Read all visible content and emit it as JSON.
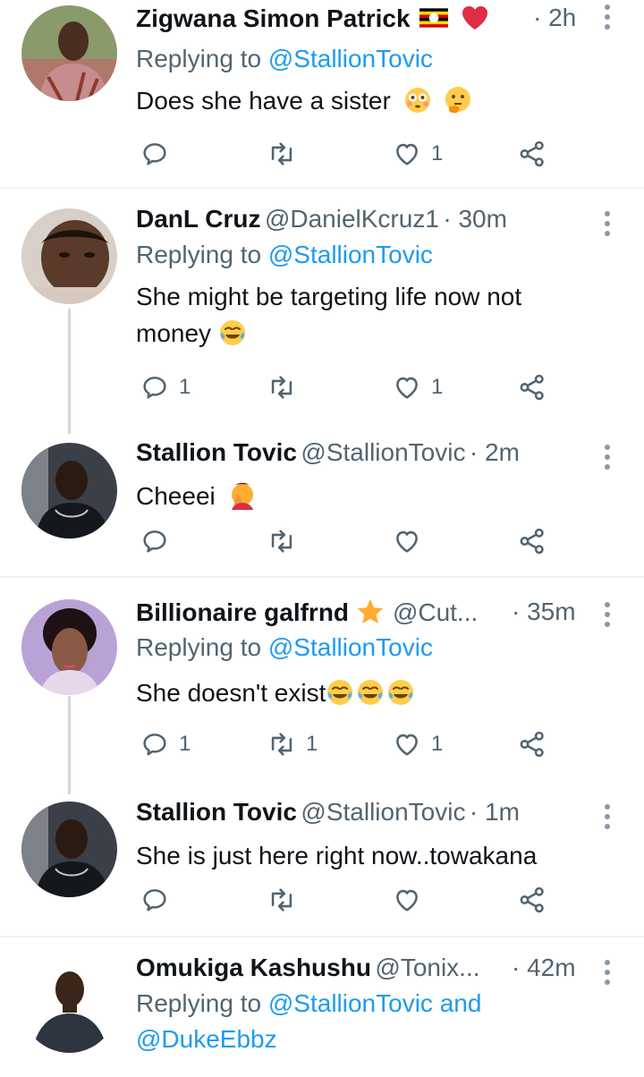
{
  "tweets": [
    {
      "name": "Zigwana Simon Patrick",
      "handle": "",
      "time": "· 2h",
      "replying_prefix": "Replying to ",
      "replying_to": "@StallionTovic",
      "text": "Does she have a sister",
      "counts": {
        "reply": "",
        "retweet": "",
        "like": "1"
      },
      "emojis": [
        "uganda-flag",
        "red-heart",
        "flushed-face",
        "thinking-face"
      ]
    },
    {
      "name": "DanL Cruz",
      "handle": "@DanielKcruz1",
      "time": "· 30m",
      "replying_prefix": "Replying to ",
      "replying_to": "@StallionTovic",
      "text_line1": "She might be targeting life now not",
      "text_line2": "money",
      "counts": {
        "reply": "1",
        "retweet": "",
        "like": "1"
      },
      "emojis": [
        "tears-of-joy"
      ]
    },
    {
      "name": "Stallion Tovic",
      "handle": "@StallionTovic",
      "time": "· 2m",
      "text": "Cheeei",
      "counts": {
        "reply": "",
        "retweet": "",
        "like": ""
      },
      "emojis": [
        "facepalm"
      ]
    },
    {
      "name": "Billionaire galfrnd",
      "handle": "@Cut...",
      "time": "· 35m",
      "replying_prefix": "Replying to ",
      "replying_to": "@StallionTovic",
      "text": "She doesn't exist",
      "counts": {
        "reply": "1",
        "retweet": "1",
        "like": "1"
      },
      "emojis": [
        "star",
        "tears-of-joy",
        "tears-of-joy",
        "tears-of-joy"
      ]
    },
    {
      "name": "Stallion Tovic",
      "handle": "@StallionTovic",
      "time": "· 1m",
      "text": "She is just here right now..towakana",
      "counts": {
        "reply": "",
        "retweet": "",
        "like": ""
      }
    },
    {
      "name": "Omukiga Kashushu",
      "handle": "@Tonix...",
      "time": "· 42m",
      "replying_prefix": "Replying to ",
      "replying_to": "@StallionTovic and",
      "replying_to_2": "@DukeEbbz"
    }
  ],
  "colors": {
    "link": "#1d9bf0",
    "secondary_text": "#536471",
    "icon": "#536471",
    "divider": "#eff3f4",
    "thread_line": "#cfd9de"
  },
  "icons": [
    "reply-icon",
    "retweet-icon",
    "like-icon",
    "share-icon",
    "more-options-icon"
  ]
}
